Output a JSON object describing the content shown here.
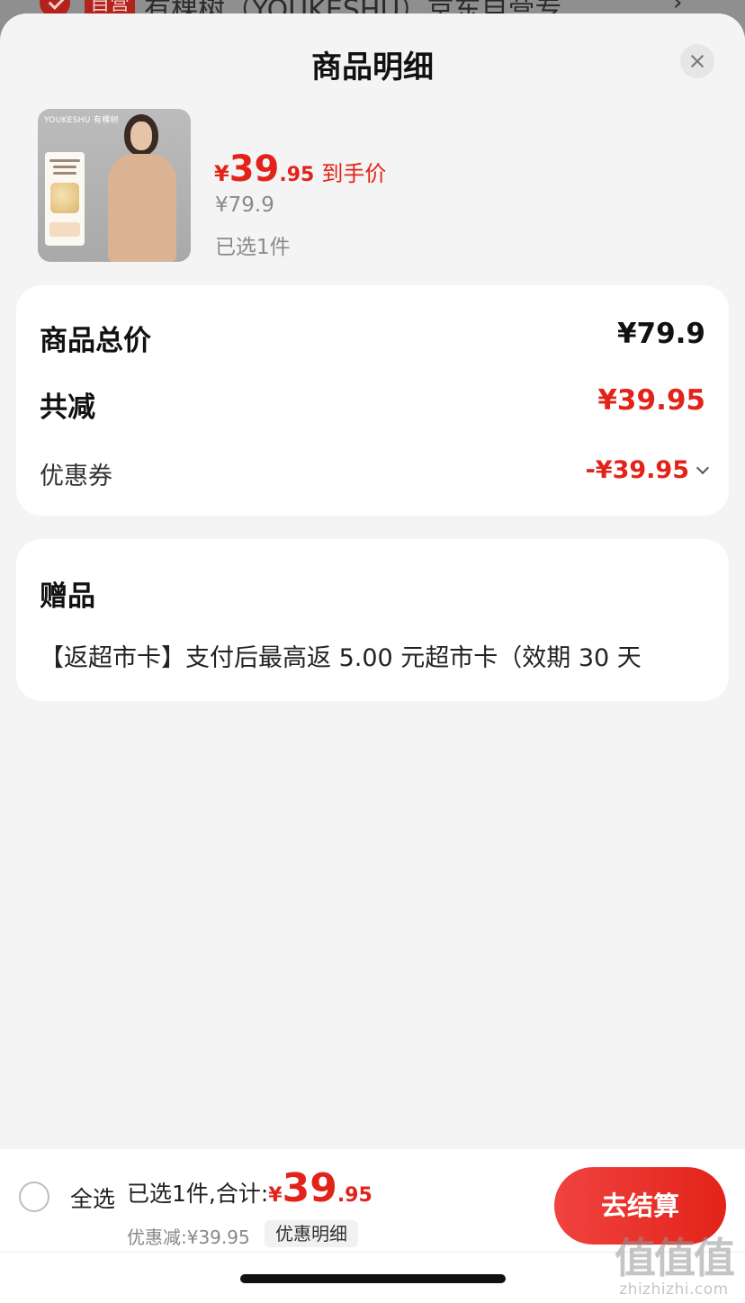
{
  "background": {
    "badge": "自营",
    "title": "有棵树（YOUKESHU）京东自营专...",
    "arrow": "›"
  },
  "sheet": {
    "title": "商品明细"
  },
  "product": {
    "brand": "YOUKESHU 有棵树",
    "price_currency": "¥",
    "price_int": "39",
    "price_dec": ".95",
    "price_label": "到手价",
    "original_price": "¥79.9",
    "selected_count": "已选1件"
  },
  "price_card": {
    "total_label": "商品总价",
    "total_value": "¥79.9",
    "reduce_label": "共减",
    "reduce_value": "¥39.95",
    "coupon_label": "优惠券",
    "coupon_value": "-¥39.95"
  },
  "gift_card": {
    "title": "赠品",
    "text": "【返超市卡】支付后最高返 5.00 元超市卡（效期 30 天"
  },
  "bottom_bar": {
    "select_all": "全选",
    "summary_text": "已选1件,合计:",
    "total_currency": "¥",
    "total_int": "39",
    "total_dec": ".95",
    "discount_text": "优惠减:¥39.95",
    "detail_chip": "优惠明细",
    "checkout": "去结算"
  },
  "watermark": {
    "big": "值值值",
    "small": "zhizhizhi.com"
  },
  "colors": {
    "accent": "#e2231a",
    "sheet_bg": "#f4f4f4",
    "card_bg": "#ffffff"
  }
}
